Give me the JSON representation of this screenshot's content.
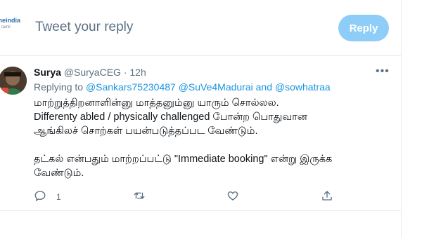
{
  "compose": {
    "logo_text": "oneindia",
    "logo_sub": "tamil",
    "placeholder": "Tweet your reply",
    "reply_button": "Reply"
  },
  "tweet": {
    "name": "Surya",
    "handle": "@SuryaCEG",
    "separator": "·",
    "time": "12h",
    "replying_prefix": "Replying to",
    "mention_1": "@Sankars75230487",
    "mention_2": "@SuVe4Madurai",
    "and_text": "and",
    "mention_3": "@sowhatraa",
    "lines": [
      "மாற்றுத்திறனாளின்னு மாத்தனும்னு யாரும் சொல்லல.",
      "Differenty abled / physically challenged போன்ற பொதுவான",
      "ஆங்கிலச் சொற்கள் பயன்படுத்தப்பட வேண்டும்.",
      "தட்கல் என்பதும் மாற்றப்பட்டு \"Immediate booking\" என்று இருக்க",
      "வேண்டும்."
    ],
    "reply_count": "1",
    "more_icon": "more-horizontal-icon"
  },
  "colors": {
    "accent": "#1b95e0",
    "reply_button_disabled": "#8ecdf8",
    "muted_text": "#5b7083"
  }
}
